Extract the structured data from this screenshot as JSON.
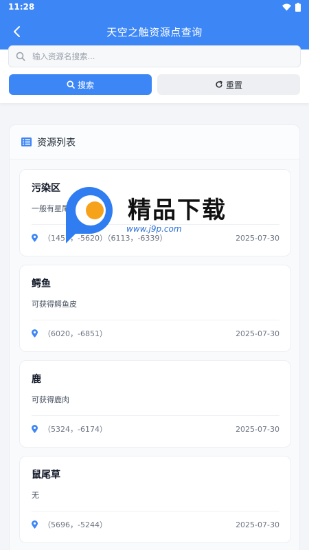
{
  "status": {
    "time": "11:28"
  },
  "header": {
    "title": "天空之触资源点查询"
  },
  "search": {
    "placeholder": "输入资源名搜索...",
    "value": ""
  },
  "buttons": {
    "search": "搜索",
    "reset": "重置"
  },
  "list": {
    "title": "资源列表",
    "items": [
      {
        "name": "污染区",
        "desc": "一般有星尾石",
        "coords": "（1457，-5620）（6113，-6339）",
        "date": "2025-07-30"
      },
      {
        "name": "鳄鱼",
        "desc": "可获得鳄鱼皮",
        "coords": "（6020，-6851）",
        "date": "2025-07-30"
      },
      {
        "name": "鹿",
        "desc": "可获得鹿肉",
        "coords": "（5324，-6174）",
        "date": "2025-07-30"
      },
      {
        "name": "鼠尾草",
        "desc": "无",
        "coords": "（5696，-5244）",
        "date": "2025-07-30"
      }
    ]
  },
  "watermark": {
    "brand": "精品下载",
    "url": "www.j9p.com"
  },
  "colors": {
    "primary": "#3d86f5",
    "watermark_orange": "#f7a21b"
  },
  "icons": [
    "back-icon",
    "wifi-icon",
    "battery-icon",
    "search-icon",
    "refresh-icon",
    "list-icon",
    "location-pin-icon"
  ]
}
